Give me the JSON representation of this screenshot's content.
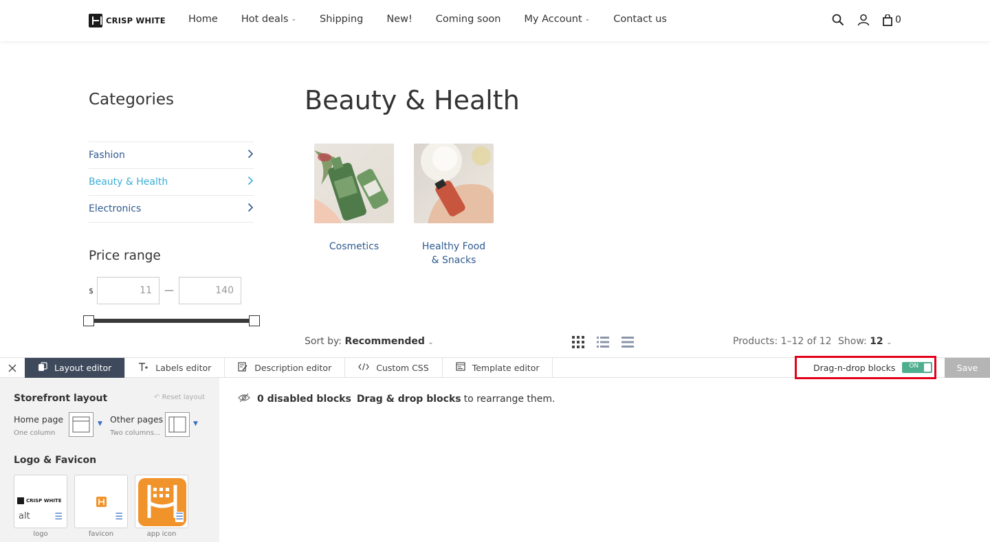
{
  "header": {
    "logo_text": "CRISP WHITE",
    "nav": [
      {
        "label": "Home",
        "has_dropdown": false
      },
      {
        "label": "Hot deals",
        "has_dropdown": true
      },
      {
        "label": "Shipping",
        "has_dropdown": false
      },
      {
        "label": "New!",
        "has_dropdown": false
      },
      {
        "label": "Coming soon",
        "has_dropdown": false
      },
      {
        "label": "My Account",
        "has_dropdown": true
      },
      {
        "label": "Contact us",
        "has_dropdown": false
      }
    ],
    "cart_count": "0",
    "icons": [
      "search-icon",
      "user-icon",
      "cart-icon"
    ]
  },
  "sidebar": {
    "categories_title": "Categories",
    "categories": [
      {
        "label": "Fashion",
        "active": false
      },
      {
        "label": "Beauty & Health",
        "active": true
      },
      {
        "label": "Electronics",
        "active": false
      }
    ],
    "price_range_title": "Price range",
    "currency": "$",
    "price_min": "11",
    "price_max": "140",
    "dash": "—"
  },
  "main": {
    "title": "Beauty & Health",
    "subcategories": [
      {
        "label": "Cosmetics"
      },
      {
        "label": "Healthy Food & Snacks",
        "line1": "Healthy Food",
        "line2": "& Snacks"
      }
    ],
    "sort_label": "Sort by:",
    "sort_value": "Recommended",
    "products_count": "Products: 1–12 of 12",
    "show_label": "Show:",
    "show_value": "12"
  },
  "editor": {
    "tabs": [
      {
        "label": "Layout editor",
        "active": true,
        "icon": "layout-icon"
      },
      {
        "label": "Labels editor",
        "active": false,
        "icon": "text-icon"
      },
      {
        "label": "Description editor",
        "active": false,
        "icon": "edit-icon"
      },
      {
        "label": "Custom CSS",
        "active": false,
        "icon": "code-icon"
      },
      {
        "label": "Template editor",
        "active": false,
        "icon": "template-icon"
      }
    ],
    "dnd_label": "Drag-n-drop blocks",
    "dnd_state": "ON",
    "save_label": "Save",
    "storefront_title": "Storefront layout",
    "reset_label": "Reset layout",
    "home_page_label": "Home page",
    "home_page_sub": "One column",
    "other_pages_label": "Other pages",
    "other_pages_sub": "Two columns...",
    "logo_favicon_title": "Logo & Favicon",
    "logo_card_alt": "alt",
    "logo_card_brand": "CRISP WHITE",
    "cards": [
      "logo",
      "favicon",
      "app icon"
    ],
    "disabled_blocks": "0 disabled blocks",
    "dnd_hint_bold": "Drag & drop blocks",
    "dnd_hint_rest": "to rearrange them.",
    "colors": {
      "active_tab": "#3e4a5c",
      "toggle": "#4fae8f",
      "highlight": "#e3001b",
      "app_icon": "#f0932b"
    }
  }
}
